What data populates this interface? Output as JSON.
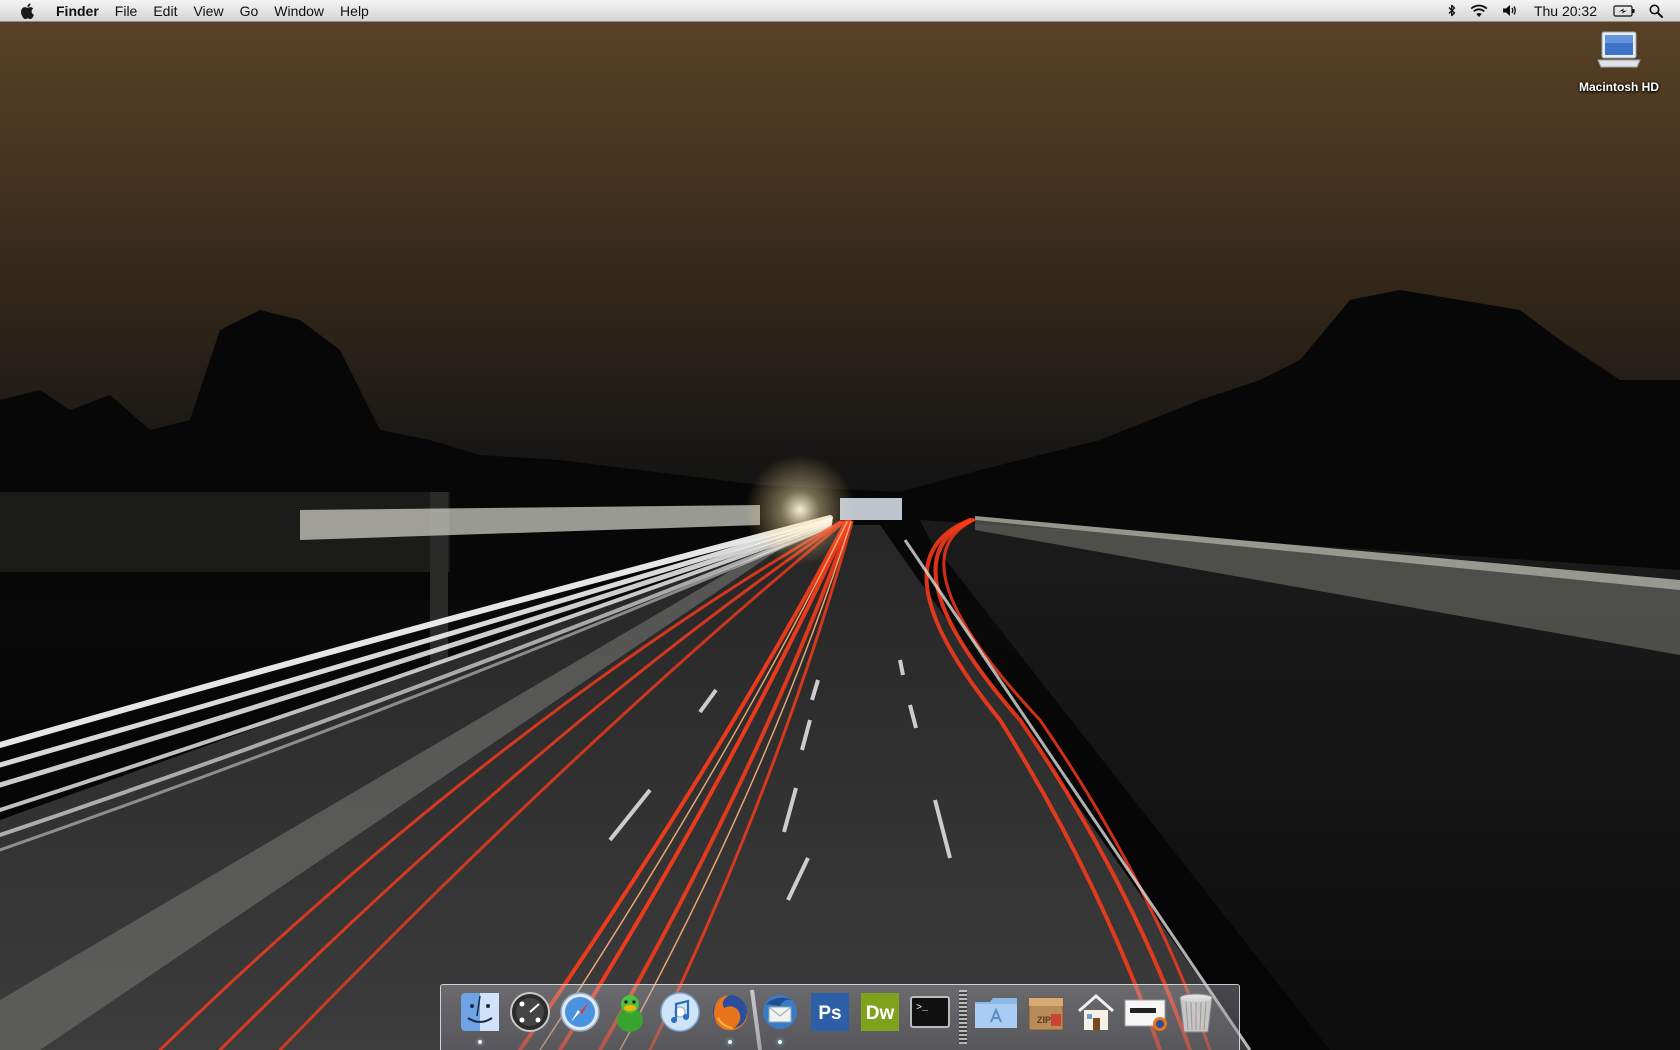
{
  "menubar": {
    "apple_icon": "apple-logo-icon",
    "app_name": "Finder",
    "menus": [
      "File",
      "Edit",
      "View",
      "Go",
      "Window",
      "Help"
    ],
    "status_icons": [
      "bluetooth-icon",
      "wifi-icon",
      "volume-icon"
    ],
    "clock": "Thu 20:32",
    "battery_icon": "battery-charging-icon",
    "spotlight_icon": "spotlight-search-icon"
  },
  "desktop": {
    "wallpaper": "night highway light trails",
    "icons": [
      {
        "label": "Macintosh HD",
        "icon": "laptop-drive-icon"
      }
    ]
  },
  "dock": {
    "apps": [
      {
        "name": "Finder",
        "icon": "finder-icon",
        "running": true
      },
      {
        "name": "Dashboard",
        "icon": "dashboard-icon",
        "running": false
      },
      {
        "name": "Safari",
        "icon": "safari-icon",
        "running": false
      },
      {
        "name": "Adium",
        "icon": "adium-duck-icon",
        "running": false
      },
      {
        "name": "iTunes",
        "icon": "itunes-icon",
        "running": false
      },
      {
        "name": "Firefox",
        "icon": "firefox-icon",
        "running": true
      },
      {
        "name": "Thunderbird",
        "icon": "thunderbird-icon",
        "running": true
      },
      {
        "name": "Photoshop",
        "icon": "photoshop-icon",
        "label": "Ps",
        "running": false
      },
      {
        "name": "Dreamweaver",
        "icon": "dreamweaver-icon",
        "label": "Dw",
        "running": false
      },
      {
        "name": "Terminal",
        "icon": "terminal-icon",
        "label": ">_",
        "running": false
      }
    ],
    "stacks": [
      {
        "name": "Applications",
        "icon": "applications-folder-icon"
      },
      {
        "name": "Archive",
        "icon": "zip-archive-icon",
        "label": "ZIP"
      },
      {
        "name": "Home",
        "icon": "home-icon"
      },
      {
        "name": "Downloads",
        "icon": "downloads-window-icon"
      },
      {
        "name": "Trash",
        "icon": "trash-icon"
      }
    ]
  }
}
